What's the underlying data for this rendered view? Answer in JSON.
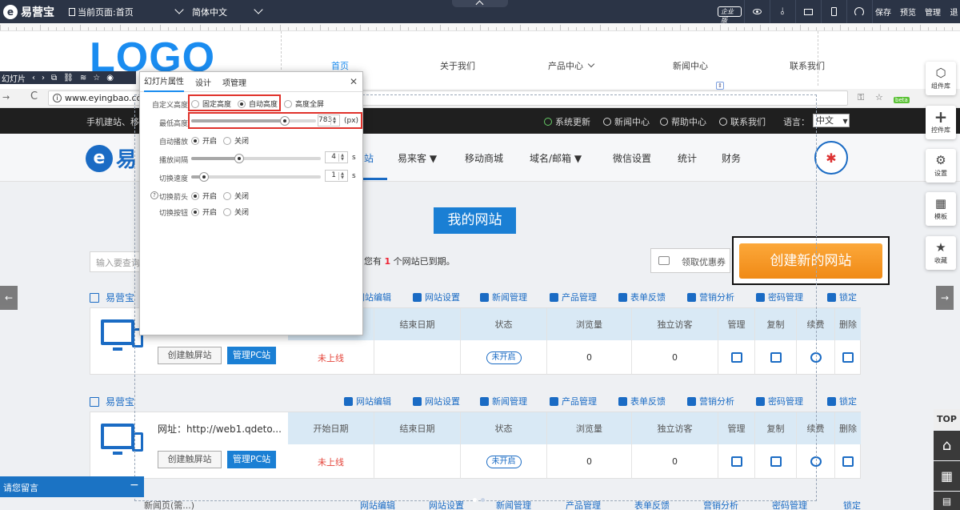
{
  "topbar": {
    "brand": "易营宝",
    "brand_icon": "logo-e-icon",
    "current_page": "当前页面:首页",
    "language": "简体中文",
    "corp_badge": "企业版",
    "actions": [
      "保存",
      "预览",
      "管理",
      "退"
    ]
  },
  "site_header": {
    "logo_text": "LOGO",
    "nav": [
      "首页",
      "关于我们",
      "产品中心",
      "新闻中心",
      "联系我们"
    ],
    "active_nav": "首页"
  },
  "slider_toolbar": {
    "label": "幻灯片",
    "icons": [
      "prev-icon",
      "next-icon",
      "copy-icon",
      "link-icon",
      "layers-icon",
      "star-icon",
      "eye-icon"
    ]
  },
  "dialog": {
    "tabs": [
      "幻灯片属性",
      "设计",
      "项管理"
    ],
    "active_tab": "幻灯片属性",
    "custom_height": {
      "label": "自定义高度",
      "options": [
        "固定高度",
        "自动高度",
        "高度全屏"
      ],
      "selected": "自动高度"
    },
    "min_height": {
      "label": "最低高度",
      "value": "783",
      "unit": "(px)",
      "level": 0.75
    },
    "autoplay": {
      "label": "自动播放",
      "on": "开启",
      "off": "关闭",
      "selected": "开启"
    },
    "interval": {
      "label": "播放间隔",
      "value": "4",
      "unit": "s",
      "level": 0.37
    },
    "speed": {
      "label": "切换速度",
      "value": "1",
      "unit": "s",
      "level": 0.1
    },
    "arrows": {
      "label": "切换箭头",
      "on": "开启",
      "off": "关闭",
      "selected": "开启",
      "help": "?"
    },
    "buttons": {
      "label": "切换按钮",
      "on": "开启",
      "off": "关闭",
      "selected": "开启"
    }
  },
  "browser": {
    "url": "www.eyingbao.co",
    "beta": "beta"
  },
  "yyb_site": {
    "top_bar_text": "手机建站、移",
    "links": [
      "系统更新",
      "新闻中心",
      "帮助中心",
      "联系我们"
    ],
    "lang_label": "语言：",
    "lang_value": "中文",
    "logo_text": "易",
    "nav": [
      "站",
      "易来客 ▼",
      "移动商城",
      "域名/邮箱 ▼",
      "微信设置",
      "统计",
      "财务"
    ],
    "my_site": "我的网站",
    "search_placeholder": "输入要查询",
    "count_prefix": "您有",
    "count_value": "1",
    "count_suffix": "个网站已到期。",
    "coupon": "领取优惠券",
    "create_button": "创建新的网站"
  },
  "site_cards": [
    {
      "title": "易营宝",
      "toolbar": [
        "网站编辑",
        "网站设置",
        "新闻管理",
        "产品管理",
        "表单反馈",
        "营销分析",
        "密码管理",
        "锁定"
      ],
      "url": "",
      "headers": [
        "结束日期",
        "状态",
        "浏览量",
        "独立访客",
        "管理",
        "复制",
        "续费",
        "删除"
      ],
      "row": [
        "未上线",
        "",
        "未开启",
        "0",
        "0"
      ],
      "btn_mobile": "创建触屏站",
      "btn_pc": "管理PC站"
    },
    {
      "title": "易营宝",
      "toolbar": [
        "网站编辑",
        "网站设置",
        "新闻管理",
        "产品管理",
        "表单反馈",
        "营销分析",
        "密码管理",
        "锁定"
      ],
      "url": "网址：http://web1.qdeto...",
      "headers": [
        "开始日期",
        "结束日期",
        "状态",
        "浏览量",
        "独立访客",
        "管理",
        "复制",
        "续费",
        "删除"
      ],
      "row": [
        "未上线",
        "",
        "未开启",
        "0",
        "0"
      ],
      "btn_mobile": "创建触屏站",
      "btn_pc": "管理PC站"
    }
  ],
  "bottom_row": {
    "left": "新闻页(需...)",
    "toolbar": [
      "网站编辑",
      "网站设置",
      "新闻管理",
      "产品管理",
      "表单反馈",
      "营销分析",
      "密码管理",
      "锁定"
    ]
  },
  "right_tools": [
    {
      "label": "组件库",
      "icon": "cube-icon"
    },
    {
      "label": "控件库",
      "icon": "plus-icon"
    },
    {
      "label": "设置",
      "icon": "gears-icon"
    },
    {
      "label": "模板",
      "icon": "grid-icon"
    },
    {
      "label": "收藏",
      "icon": "star-icon"
    }
  ],
  "side_tools": {
    "top": "TOP",
    "message": "请您留言"
  }
}
